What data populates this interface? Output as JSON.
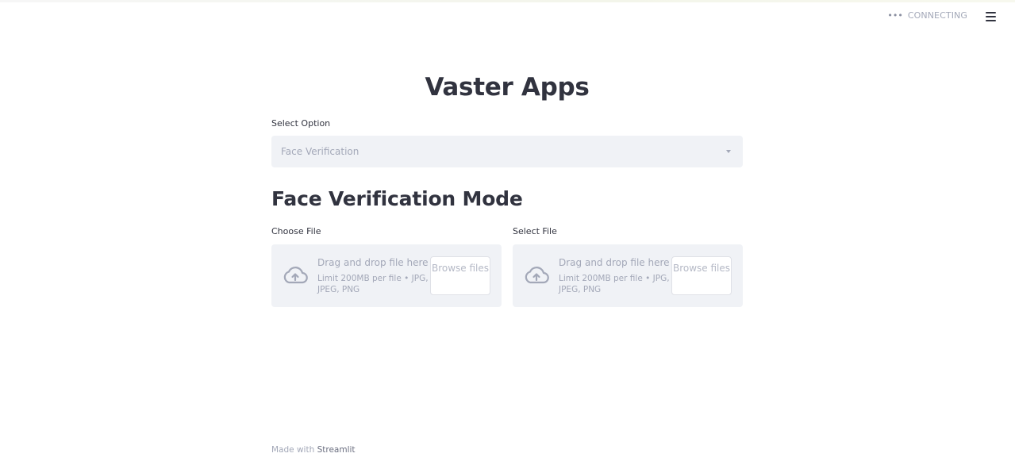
{
  "header": {
    "status_dots": "•••",
    "status_text": "CONNECTING",
    "menu_icon": "hamburger-menu-icon"
  },
  "main": {
    "title": "Vaster Apps",
    "select": {
      "label": "Select Option",
      "value": "Face Verification"
    },
    "subtitle": "Face Verification Mode",
    "uploaders": [
      {
        "label": "Choose File",
        "drag_text": "Drag and drop file here",
        "limit_text": "Limit 200MB per file • JPG, JPEG, PNG",
        "button": "Browse files"
      },
      {
        "label": "Select File",
        "drag_text": "Drag and drop file here",
        "limit_text": "Limit 200MB per file • JPG, JPEG, PNG",
        "button": "Browse files"
      }
    ]
  },
  "footer": {
    "prefix": "Made with",
    "link": "Streamlit"
  }
}
